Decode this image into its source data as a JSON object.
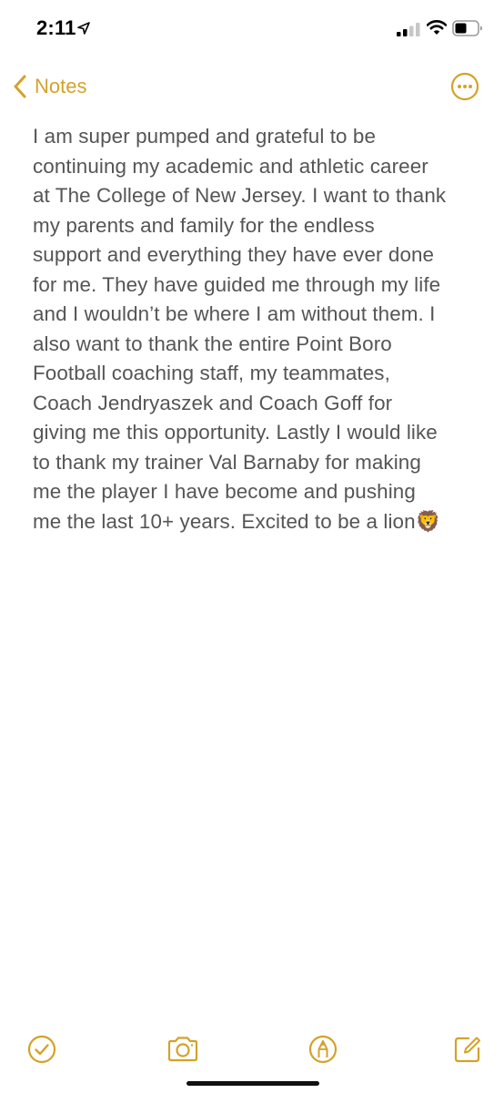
{
  "status_bar": {
    "time": "2:11"
  },
  "nav": {
    "back_label": "Notes"
  },
  "note": {
    "lines": [
      "I am super pumped and grateful to be",
      "continuing my academic and athletic career",
      "at The College of New Jersey. I want to thank",
      "my parents and family for the endless",
      "support and everything they have ever done",
      "for me. They have guided me through my life",
      "and I wouldn’t be where I am without them. I",
      "also want to thank the entire Point Boro",
      "Football coaching staff, my teammates,",
      "Coach Jendryaszek and Coach Goff for",
      "giving me this opportunity. Lastly I would like",
      "to thank my trainer Val Barnaby for making",
      "me the player I have become and pushing",
      "me the last 10+ years. Excited to be a lion🦁"
    ]
  },
  "toolbar": {
    "icons": [
      "checklist-icon",
      "camera-icon",
      "markup-icon",
      "compose-icon"
    ]
  },
  "colors": {
    "accent": "#d4a22a",
    "text": "#555555",
    "background": "#ffffff"
  }
}
